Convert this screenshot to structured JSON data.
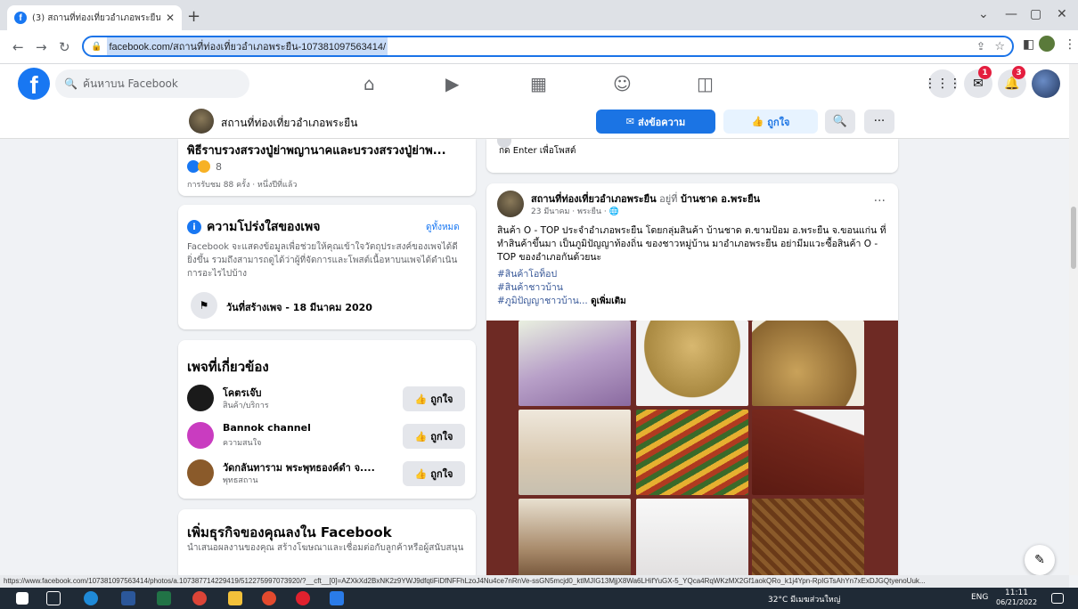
{
  "browser": {
    "tab_title": "(3) สถานที่ท่องเที่ยวอำเภอพระยืน | Fa",
    "url": "facebook.com/สถานที่ท่องเที่ยวอำเภอพระยืน-107381097563414/",
    "status_url": "https://www.facebook.com/107381097563414/photos/a.107387714229419/512275997073920/?__cft__[0]=AZXkXd2BxNK2z9YWJ9dfqtiFiDfNFFhLzoJ4Nu4ce7nRnVe-ssGN5mcjd0_ktlMJIG13MjjX8Wa6LHifYuGX-5_YQca4RqWKzMX2Gf1aokQRo_k1j4Ypn-RpIGTsAhYn7xExDJGQtyenoUuk..."
  },
  "fb": {
    "search_placeholder": "ค้นหาบน Facebook",
    "badges": {
      "messenger": "1",
      "notifications": "3"
    }
  },
  "page_header": {
    "name": "สถานที่ท่องเที่ยวอำเภอพระยืน",
    "message_label": "ส่งข้อความ",
    "like_label": "ถูกใจ",
    "search_glyph": "🔍",
    "more_glyph": "···"
  },
  "left_top_post": {
    "title": "พิธีราบรวงสรวงปู่ย่าพญานาคและบรวงสรวงปู่ย่าพ...",
    "reaction_count": "8",
    "views": "การรับชม 88 ครั้ง · หนึ่งปีที่แล้ว"
  },
  "transparency": {
    "title": "ความโปร่งใสของเพจ",
    "see_all": "ดูทั้งหมด",
    "description": "Facebook จะแสดงข้อมูลเพื่อช่วยให้คุณเข้าใจวัตถุประสงค์ของเพจได้ดียิ่งขึ้น รวมถึงสามารถดูได้ว่าผู้ที่จัดการและโพสต์เนื้อหาบนเพจได้ดำเนินการอะไรไปบ้าง",
    "created": "วันที่สร้างเพจ - 18 มีนาคม 2020"
  },
  "related": {
    "title": "เพจที่เกี่ยวข้อง",
    "like_label": "ถูกใจ",
    "items": [
      {
        "name": "โคตรเจ๊บ",
        "category": "สินค้า/บริการ",
        "avatar_color": "#1a1a1a"
      },
      {
        "name": "Bannok channel",
        "category": "ความสนใจ",
        "avatar_color": "#c93cc0"
      },
      {
        "name": "วัดกลันทาราม พระพุทธองค์ดำ จ....",
        "category": "พุทธสถาน",
        "avatar_color": "#8a5a2a"
      }
    ]
  },
  "business": {
    "title": "เพิ่มธุรกิจของคุณลงใน Facebook",
    "text": "นำเสนอผลงานของคุณ สร้างโฆษณาและเชื่อมต่อกับลูกค้าหรือผู้สนับสนุน"
  },
  "comment_box": {
    "hint": "กด Enter เพื่อโพสต์"
  },
  "post": {
    "author": "สถานที่ท่องเที่ยวอำเภอพระยืน",
    "at_word": "อยู่ที่",
    "location": "บ้านชาด อ.พระยืน",
    "meta": "23 มีนาคม · พระยืน · 🌐",
    "body": "สินค้า O - TOP ประจำอำเภอพระยืน โดยกลุ่มสินค้า บ้านชาด ต.ขามป้อม อ.พระยืน จ.ขอนแก่น ที่ทำสินค้าขึ้นมา เป็นภูมิปัญญาท้องถิ่น ของชาวหมู่บ้าน มาอำเภอพระยืน อย่ามีมแวะซื้อสินค้า O - TOP ของอำเภอกันด้วยนะ",
    "hashtags": [
      "#สินค้าโอท็อป",
      "#สินค้าชาวบ้าน",
      "#ภูมิปัญญาชาวบ้าน..."
    ],
    "see_more": "ดูเพิ่มเติม"
  },
  "taskbar": {
    "weather": "32°C มีเมฆส่วนใหญ่",
    "lang": "ENG",
    "time": "11:11",
    "date": "06/21/2022"
  }
}
